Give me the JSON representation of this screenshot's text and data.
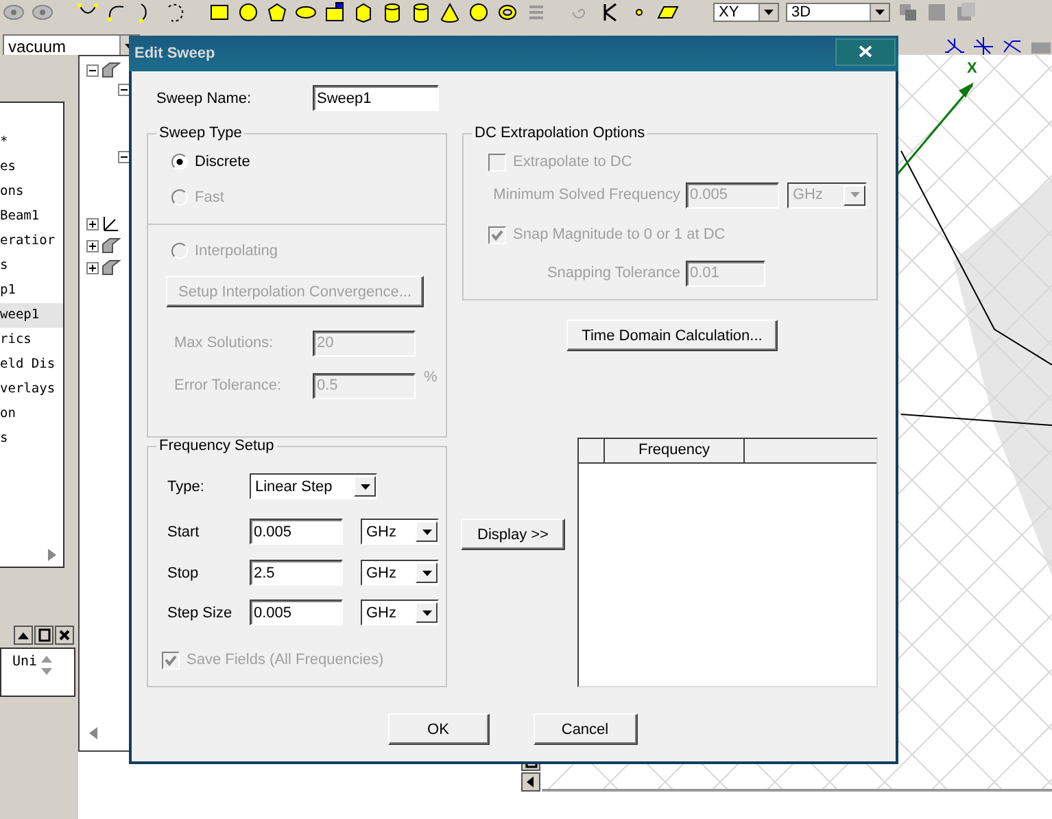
{
  "app": {
    "material_combo": "vacuum",
    "plane_combo": "XY",
    "view_combo": "3D",
    "axis_label": "X",
    "lower_panel_text": "Uni",
    "tree_nodes": [
      {
        "expanded": true
      },
      {
        "expanded": true
      },
      {
        "expanded": true
      },
      {
        "expanded": false
      },
      {
        "expanded": false
      },
      {
        "expanded": false
      }
    ],
    "project_items": [
      {
        "label": "*",
        "selected": false
      },
      {
        "label": "es",
        "selected": false
      },
      {
        "label": "ons",
        "selected": false
      },
      {
        "label": "Beam1",
        "selected": false
      },
      {
        "label": "eratior",
        "selected": false
      },
      {
        "label": "s",
        "selected": false
      },
      {
        "label": "p1",
        "selected": false
      },
      {
        "label": "weep1",
        "selected": true
      },
      {
        "label": "rics",
        "selected": false
      },
      {
        "label": "eld Dis",
        "selected": false
      },
      {
        "label": "verlays",
        "selected": false
      },
      {
        "label": "on",
        "selected": false
      },
      {
        "label": "s",
        "selected": false
      }
    ]
  },
  "dialog": {
    "title": "Edit Sweep",
    "sweep_name": {
      "label": "Sweep Name:",
      "value": "Sweep1"
    },
    "sweep_type": {
      "title": "Sweep Type",
      "options": [
        {
          "label": "Discrete",
          "selected": true,
          "disabled": false
        },
        {
          "label": "Fast",
          "selected": false,
          "disabled": true
        },
        {
          "label": "Interpolating",
          "selected": false,
          "disabled": true
        }
      ],
      "convergence_button": {
        "label": "Setup Interpolation Convergence...",
        "disabled": true
      },
      "fields": [
        {
          "label": "Max Solutions:",
          "value": "20",
          "disabled": true
        },
        {
          "label": "Error Tolerance:",
          "value": "0.5",
          "unit": "%",
          "disabled": true
        }
      ]
    },
    "dc_extrapolation": {
      "title": "DC Extrapolation Options",
      "extrapolate": {
        "label": "Extrapolate to DC",
        "checked": false,
        "disabled": true
      },
      "min_frequency": {
        "label": "Minimum Solved Frequency",
        "value": "0.005",
        "unit": "GHz",
        "disabled": true
      },
      "snap": {
        "label": "Snap Magnitude to 0 or 1 at DC",
        "checked": true,
        "disabled": true
      },
      "snap_tolerance": {
        "label": "Snapping Tolerance",
        "value": "0.01",
        "disabled": true
      }
    },
    "time_domain_button": "Time Domain Calculation...",
    "frequency_setup": {
      "title": "Frequency Setup",
      "type": {
        "label": "Type:",
        "value": "Linear Step"
      },
      "rows": [
        {
          "label": "Start",
          "value": "0.005",
          "unit": "GHz"
        },
        {
          "label": "Stop",
          "value": "2.5",
          "unit": "GHz"
        },
        {
          "label": "Step Size",
          "value": "0.005",
          "unit": "GHz"
        }
      ],
      "save_fields": {
        "label": "Save Fields (All Frequencies)",
        "checked": true,
        "disabled": true
      }
    },
    "display_button": "Display >>",
    "table": {
      "columns": [
        "Frequency"
      ]
    },
    "buttons": [
      "OK",
      "Cancel"
    ]
  }
}
